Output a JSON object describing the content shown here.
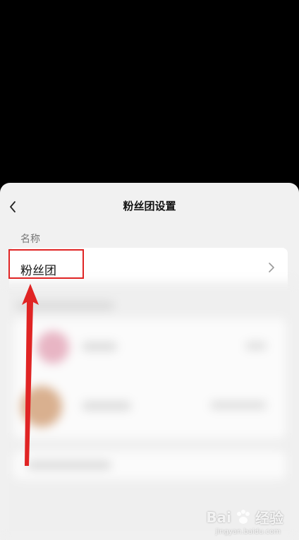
{
  "header": {
    "title": "粉丝团设置"
  },
  "section": {
    "label": "名称"
  },
  "name_row": {
    "value": "粉丝团"
  },
  "annotation": {
    "color": "#e02424"
  },
  "watermark": {
    "brand": "Bai",
    "brand_suffix": "经验",
    "url": "jingyan.baidu.com"
  }
}
